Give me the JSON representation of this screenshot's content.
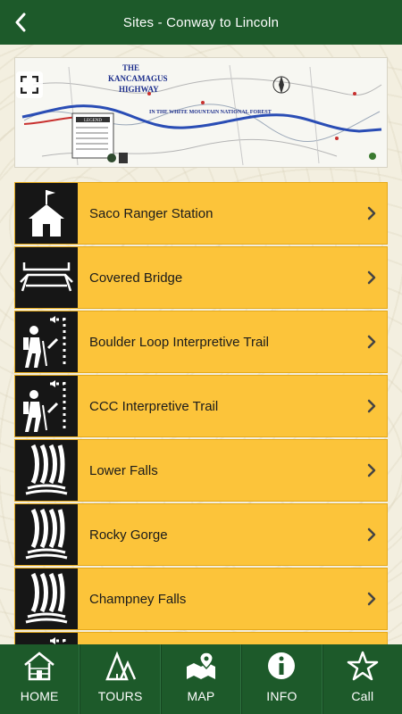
{
  "header": {
    "title": "Sites - Conway to Lincoln"
  },
  "map": {
    "title_line1": "THE",
    "title_line2": "KANCAMAGUS",
    "title_line3": "HIGHWAY",
    "subtitle": "IN THE WHITE MOUNTAIN NATIONAL FOREST",
    "legend_label": "LEGEND"
  },
  "sites": [
    {
      "label": "Saco Ranger Station",
      "icon": "ranger-station-icon"
    },
    {
      "label": "Covered Bridge",
      "icon": "covered-bridge-icon"
    },
    {
      "label": "Boulder Loop Interpretive Trail",
      "icon": "hiking-trail-icon"
    },
    {
      "label": "CCC Interpretive Trail",
      "icon": "hiking-trail-icon"
    },
    {
      "label": "Lower Falls",
      "icon": "waterfall-icon"
    },
    {
      "label": "Rocky Gorge",
      "icon": "waterfall-icon"
    },
    {
      "label": "Champney Falls",
      "icon": "waterfall-icon"
    }
  ],
  "tabs": [
    {
      "label": "HOME",
      "icon": "home-icon"
    },
    {
      "label": "TOURS",
      "icon": "tours-icon"
    },
    {
      "label": "MAP",
      "icon": "map-icon"
    },
    {
      "label": "INFO",
      "icon": "info-icon"
    },
    {
      "label": "Call",
      "icon": "star-icon"
    }
  ],
  "colors": {
    "header": "#1d5a2a",
    "item": "#fcc43a",
    "icon_bg": "#161616"
  }
}
